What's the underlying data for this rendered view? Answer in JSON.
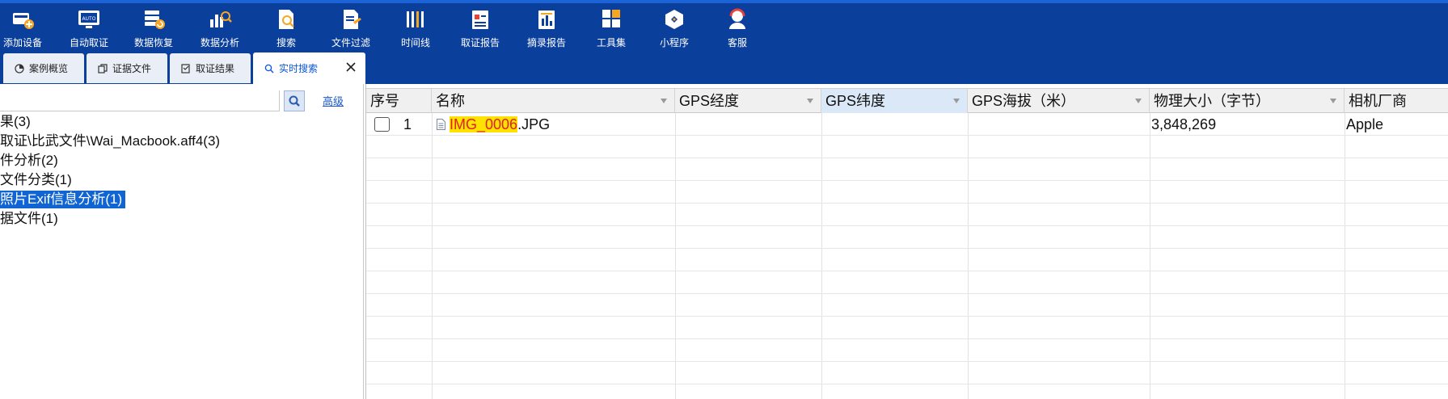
{
  "toolbar": {
    "items": [
      {
        "label": "添加设备",
        "icon": "add-device-icon"
      },
      {
        "label": "自动取证",
        "icon": "auto-forensics-icon"
      },
      {
        "label": "数据恢复",
        "icon": "data-recovery-icon"
      },
      {
        "label": "数据分析",
        "icon": "data-analysis-icon"
      },
      {
        "label": "搜索",
        "icon": "search-doc-icon"
      },
      {
        "label": "文件过滤",
        "icon": "file-filter-icon"
      },
      {
        "label": "时间线",
        "icon": "timeline-icon"
      },
      {
        "label": "取证报告",
        "icon": "forensics-report-icon"
      },
      {
        "label": "摘录报告",
        "icon": "excerpt-report-icon"
      },
      {
        "label": "工具集",
        "icon": "toolset-icon"
      },
      {
        "label": "小程序",
        "icon": "mini-program-icon"
      },
      {
        "label": "客服",
        "icon": "customer-service-icon"
      }
    ]
  },
  "tabs": [
    {
      "label": "案例概览",
      "icon": "pie-chart-icon"
    },
    {
      "label": "证据文件",
      "icon": "copy-icon"
    },
    {
      "label": "取证结果",
      "icon": "checklist-icon"
    },
    {
      "label": "实时搜索",
      "icon": "magnifier-icon",
      "active": true
    }
  ],
  "left_panel": {
    "search_value": "",
    "advanced_label": "高级",
    "tree": [
      "果(3)",
      "取证\\比武文件\\Wai_Macbook.aff4(3)",
      "件分析(2)",
      "文件分类(1)",
      "照片Exif信息分析(1)",
      "据文件(1)"
    ],
    "selected_index": 4
  },
  "grid": {
    "columns": [
      "序号",
      "名称",
      "GPS经度",
      "GPS纬度",
      "GPS海拔（米）",
      "物理大小（字节）",
      "相机厂商"
    ],
    "selected_column": 3,
    "rows": [
      {
        "index": "1",
        "name_highlight": "IMG_0006",
        "name_rest": ".JPG",
        "gps_lon": "",
        "gps_lat": "",
        "gps_alt": "",
        "size": "3,848,269",
        "vendor": "Apple"
      }
    ]
  },
  "colors": {
    "toolbar_bg": "#0b3f9c",
    "accent": "#1065d3",
    "highlight_bg": "#ffe300",
    "highlight_fg": "#e02020"
  }
}
